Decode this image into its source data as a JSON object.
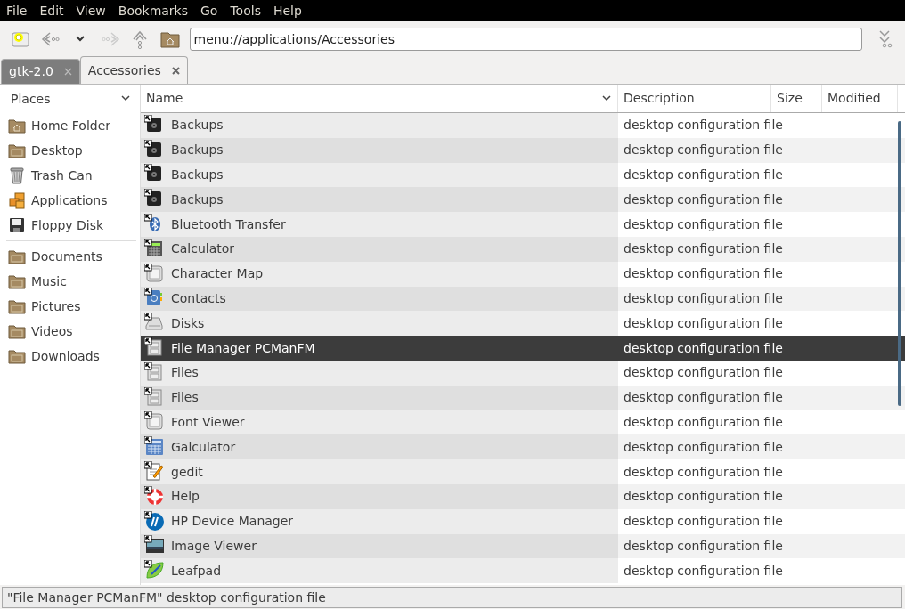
{
  "menu_bar": [
    "File",
    "Edit",
    "View",
    "Bookmarks",
    "Go",
    "Tools",
    "Help"
  ],
  "toolbar": {
    "address": "menu://applications/Accessories"
  },
  "tabs": [
    {
      "label": "gtk-2.0",
      "selected": false
    },
    {
      "label": "Accessories",
      "selected": true
    }
  ],
  "sidebar": {
    "title": "Places",
    "groups": [
      [
        {
          "label": "Home Folder",
          "kind": "home"
        },
        {
          "label": "Desktop",
          "kind": "folder"
        },
        {
          "label": "Trash Can",
          "kind": "trash"
        },
        {
          "label": "Applications",
          "kind": "apps"
        },
        {
          "label": "Floppy Disk",
          "kind": "floppy"
        }
      ],
      [
        {
          "label": "Documents",
          "kind": "folder"
        },
        {
          "label": "Music",
          "kind": "folder"
        },
        {
          "label": "Pictures",
          "kind": "folder"
        },
        {
          "label": "Videos",
          "kind": "folder"
        },
        {
          "label": "Downloads",
          "kind": "folder"
        }
      ]
    ]
  },
  "table": {
    "columns": [
      {
        "label": "Name",
        "sorted": true
      },
      {
        "label": "Description",
        "sorted": false
      },
      {
        "label": "Size",
        "sorted": false
      },
      {
        "label": "Modified",
        "sorted": false
      }
    ],
    "rows": [
      {
        "name": "Backups",
        "description": "desktop configuration file",
        "kind": "backup",
        "selected": false
      },
      {
        "name": "Backups",
        "description": "desktop configuration file",
        "kind": "backup",
        "selected": false
      },
      {
        "name": "Backups",
        "description": "desktop configuration file",
        "kind": "backup",
        "selected": false
      },
      {
        "name": "Backups",
        "description": "desktop configuration file",
        "kind": "backup",
        "selected": false
      },
      {
        "name": "Bluetooth Transfer",
        "description": "desktop configuration file",
        "kind": "bluetooth",
        "selected": false
      },
      {
        "name": "Calculator",
        "description": "desktop configuration file",
        "kind": "calculator",
        "selected": false
      },
      {
        "name": "Character Map",
        "description": "desktop configuration file",
        "kind": "key",
        "selected": false
      },
      {
        "name": "Contacts",
        "description": "desktop configuration file",
        "kind": "contacts",
        "selected": false
      },
      {
        "name": "Disks",
        "description": "desktop configuration file",
        "kind": "disk",
        "selected": false
      },
      {
        "name": "File Manager PCManFM",
        "description": "desktop configuration file",
        "kind": "cabinet",
        "selected": true
      },
      {
        "name": "Files",
        "description": "desktop configuration file",
        "kind": "cabinet",
        "selected": false
      },
      {
        "name": "Files",
        "description": "desktop configuration file",
        "kind": "cabinet",
        "selected": false
      },
      {
        "name": "Font Viewer",
        "description": "desktop configuration file",
        "kind": "key",
        "selected": false
      },
      {
        "name": "Galculator",
        "description": "desktop configuration file",
        "kind": "galculator",
        "selected": false
      },
      {
        "name": "gedit",
        "description": "desktop configuration file",
        "kind": "editor",
        "selected": false
      },
      {
        "name": "Help",
        "description": "desktop configuration file",
        "kind": "help",
        "selected": false
      },
      {
        "name": "HP Device Manager",
        "description": "desktop configuration file",
        "kind": "hp",
        "selected": false
      },
      {
        "name": "Image Viewer",
        "description": "desktop configuration file",
        "kind": "image",
        "selected": false
      },
      {
        "name": "Leafpad",
        "description": "desktop configuration file",
        "kind": "leaf",
        "selected": false
      }
    ]
  },
  "status_bar": "\"File Manager PCManFM\" desktop configuration file"
}
